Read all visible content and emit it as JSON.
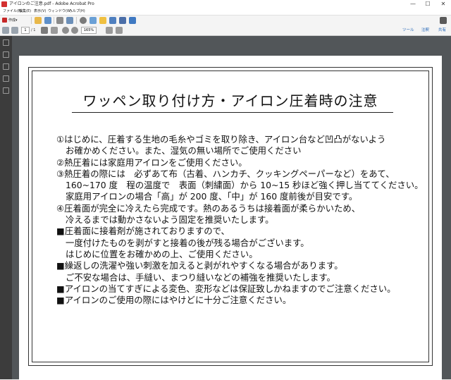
{
  "window": {
    "title": "アイロンのご注意.pdf - Adobe Acrobat Pro",
    "minimize": "—",
    "maximize": "☐",
    "close": "✕"
  },
  "menu": [
    "ファイル(F)",
    "編集(E)",
    "表示(V)",
    "ウィンドウ(W)",
    "ヘルプ(H)"
  ],
  "toolbar": {
    "create_label": "作成",
    "create_chevron": "▾"
  },
  "nav": {
    "page_current": "1",
    "page_total": "/ 1",
    "zoom": "165%",
    "tools": "ツール",
    "comment": "注釈",
    "share": "共有"
  },
  "document": {
    "title": "ワッペン取り付け方・アイロン圧着時の注意",
    "lines": [
      "①はじめに、圧着する生地の毛糸やゴミを取り除き、アイロン台など凹凸がないよう",
      "お確かめください。また、湿気の無い場所でご使用ください",
      "②熱圧着には家庭用アイロンをご使用ください。",
      "③熱圧着の際には　必ずあて布（古着、ハンカチ、クッキングペーパーなど）をあて、",
      "160~170 度　程の温度で　表面（刺繍面）から 10~15 秒ほど強く押し当ててください。",
      "家庭用アイロンの場合「高」が 200 度、「中」が 160 度前後が目安です。",
      "④圧着面が完全に冷えたら完成です。熱のあるうちは接着面が柔らかいため、",
      "冷えるまでは動かさないよう固定を推奨いたします。",
      "■圧着面に接着剤が施されておりますので、",
      "一度付けたものを剥がすと接着の後が残る場合がございます。",
      "はじめに位置をお確かめの上、ご使用ください。",
      "■繰返しの洗濯や強い刺激を加えると剥がれやすくなる場合があります。",
      "ご不安な場合は、手縫い、まつり縫いなどの補強を推奨いたします。",
      "■アイロンの当てすぎによる変色、変形などは保証致しかねますのでご注意ください。",
      "■アイロンのご使用の際にはやけどに十分ご注意ください。"
    ]
  }
}
